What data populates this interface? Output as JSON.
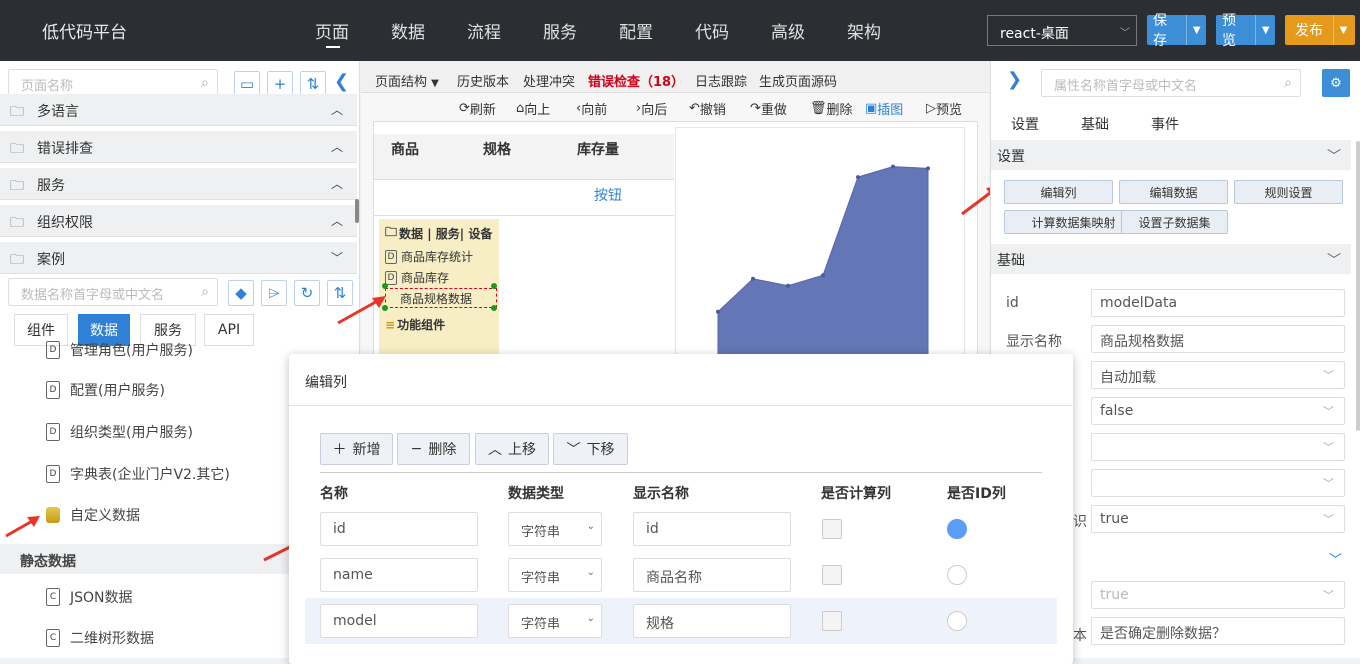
{
  "header": {
    "app_title": "低代码平台",
    "nav": [
      "页面",
      "数据",
      "流程",
      "服务",
      "配置",
      "代码",
      "高级",
      "架构"
    ],
    "env_select": "react-桌面",
    "save": "保存",
    "preview": "预览",
    "publish": "发布",
    "colors": {
      "save": "#3c8ed6",
      "preview": "#3c8ed6",
      "publish": "#e59a1c"
    }
  },
  "left": {
    "page_search_placeholder": "页面名称",
    "accordions": [
      "多语言",
      "错误排查",
      "服务",
      "组织权限",
      "案例"
    ],
    "data_search_placeholder": "数据名称首字母或中文名",
    "tabs": [
      "组件",
      "数据",
      "服务",
      "API"
    ],
    "items": [
      {
        "label": "管理角色(用户服务)",
        "icon": "D"
      },
      {
        "label": "配置(用户服务)",
        "icon": "D"
      },
      {
        "label": "组织类型(用户服务)",
        "icon": "D"
      },
      {
        "label": "字典表(企业门户V2.其它)",
        "icon": "D"
      },
      {
        "label": "自定义数据",
        "icon": "db"
      }
    ],
    "static_header": "静态数据",
    "static_items": [
      {
        "label": "JSON数据",
        "icon": "C"
      },
      {
        "label": "二维树形数据",
        "icon": "C"
      }
    ]
  },
  "center": {
    "tabs": [
      "页面结构",
      "历史版本",
      "处理冲突",
      "错误检查（18）",
      "日志跟踪",
      "生成页面源码"
    ],
    "tools": [
      "刷新",
      "向上",
      "向前",
      "向后",
      "撤销",
      "重做",
      "删除",
      "插图",
      "预览"
    ],
    "table_headers": [
      "商品",
      "规格",
      "库存量"
    ],
    "button_label": "按钮",
    "tree": {
      "root": "数据 | 服务| 设备",
      "items": [
        "商品库存统计",
        "商品库存",
        "商品规格数据"
      ],
      "footer": "功能组件"
    },
    "chart_data": {
      "type": "area",
      "x": [
        1,
        2,
        3,
        4,
        5,
        6,
        7
      ],
      "values": [
        120,
        158,
        150,
        162,
        275,
        287,
        285
      ]
    }
  },
  "right": {
    "search_placeholder": "属性名称首字母或中文名",
    "tabs": [
      "设置",
      "基础",
      "事件"
    ],
    "section_settings": "设置",
    "buttons": [
      "编辑列",
      "编辑数据",
      "规则设置",
      "计算数据集映射",
      "设置子数据集"
    ],
    "section_basic": "基础",
    "fields": [
      {
        "label": "id",
        "value": "modelData"
      },
      {
        "label": "显示名称",
        "value": "商品规格数据"
      },
      {
        "label": "",
        "value": "自动加载"
      },
      {
        "label": "",
        "value": "false"
      },
      {
        "label": "",
        "value": ""
      },
      {
        "label": "",
        "value": ""
      },
      {
        "label": "识",
        "value": "true"
      }
    ],
    "lower": [
      {
        "label": "",
        "value": "true"
      },
      {
        "label": "本",
        "value": "是否确定删除数据？"
      }
    ]
  },
  "dialog": {
    "title": "编辑列",
    "buttons": [
      "新增",
      "删除",
      "上移",
      "下移"
    ],
    "headers": [
      "名称",
      "数据类型",
      "显示名称",
      "是否计算列",
      "是否ID列"
    ],
    "rows": [
      {
        "name": "id",
        "type": "字符串",
        "display": "id",
        "is_id": true
      },
      {
        "name": "name",
        "type": "字符串",
        "display": "商品名称",
        "is_id": false
      },
      {
        "name": "model",
        "type": "字符串",
        "display": "规格",
        "is_id": false
      }
    ]
  }
}
